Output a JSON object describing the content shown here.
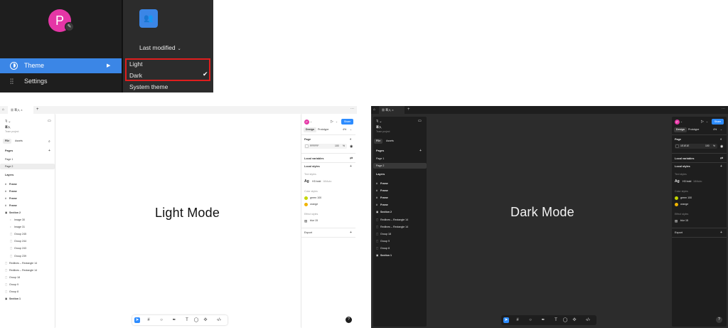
{
  "menu": {
    "avatar_letter": "P",
    "items": [
      {
        "label": "Theme"
      },
      {
        "label": "Settings"
      }
    ],
    "sort_label": "Last modified",
    "theme_options": [
      {
        "label": "Light"
      },
      {
        "label": "Dark"
      },
      {
        "label": "System theme"
      }
    ]
  },
  "light": {
    "canvas_title": "Light Mode",
    "file_tab": "草入",
    "project_name": "草入",
    "team": "Team project",
    "left_tabs": [
      "File",
      "Assets"
    ],
    "pages_header": "Pages",
    "pages": [
      "Page 1",
      "Page 2"
    ],
    "layers_header": "Layers",
    "layers": [
      "Frame",
      "Frame",
      "Frame",
      "Frame",
      "Section 2",
      "Image 30",
      "Image 31",
      "Group 245",
      "Group 244",
      "Group 243",
      "Group 239",
      "Redlines – Rectangle 14",
      "Redlines – Rectangle 14",
      "Group 18",
      "Group 9",
      "Group 8",
      "Section 1"
    ],
    "avatar_letter": "P",
    "share": "Share",
    "right_tabs": [
      "Design",
      "Prototype"
    ],
    "zoom": "4%",
    "page_label": "Page",
    "page_color": "FFFFFF",
    "page_opacity": "100",
    "percent": "%",
    "local_variables": "Local variables",
    "local_styles": "Local styles",
    "text_styles": "Text styles",
    "ag": "Ag",
    "text_style_name": "H3 bold",
    "text_style_meta": "18/Auto",
    "color_styles": "Color styles",
    "color_style_1": "green 100",
    "color_style_2": "orange",
    "effect_styles": "Effect styles",
    "effect_style_1": "blur 15",
    "export": "Export",
    "help": "?"
  },
  "dark": {
    "canvas_title": "Dark Mode",
    "file_tab": "草入",
    "project_name": "草入",
    "team": "Team project",
    "left_tabs": [
      "File",
      "Assets"
    ],
    "pages_header": "Pages",
    "pages": [
      "Page 1",
      "Page 2"
    ],
    "layers_header": "Layers",
    "layers": [
      "Frame",
      "Frame",
      "Frame",
      "Frame",
      "Section 2",
      "Redlines – Rectangle 14",
      "Redlines – Rectangle 14",
      "Group 18",
      "Group 9",
      "Group 8",
      "Section 1"
    ],
    "avatar_letter": "P",
    "share": "Share",
    "right_tabs": [
      "Design",
      "Prototype"
    ],
    "zoom": "4%",
    "page_label": "Page",
    "page_color": "1E1E1E",
    "page_opacity": "100",
    "percent": "%",
    "local_variables": "Local variables",
    "local_styles": "Local styles",
    "text_styles": "Text styles",
    "ag": "Ag",
    "text_style_name": "H3 bold",
    "text_style_meta": "18/Auto",
    "color_styles": "Color styles",
    "color_style_1": "green 100",
    "color_style_2": "orange",
    "effect_styles": "Effect styles",
    "effect_style_1": "blur 15",
    "export": "Export",
    "help": "?"
  },
  "colors": {
    "accent": "#3b86e6",
    "highlight": "#e01e1e",
    "avatar": "#e536a6",
    "green_style": "#c4d600",
    "orange_style": "#f0b400"
  }
}
